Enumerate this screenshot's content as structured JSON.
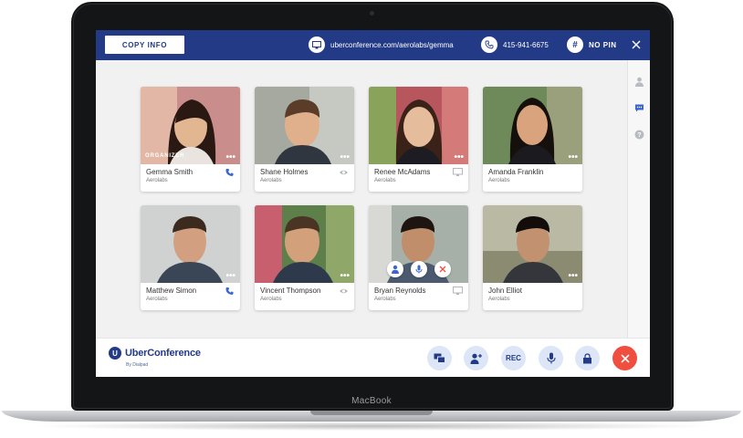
{
  "device": {
    "brand_label": "MacBook"
  },
  "topbar": {
    "copy_info_label": "COPY INFO",
    "conference_url": "uberconference.com/aerolabs/gemma",
    "phone_number": "415-941-6675",
    "pin_label": "NO PIN",
    "icons": [
      "screen-icon",
      "phone-icon",
      "hash-icon",
      "close-icon"
    ]
  },
  "rail": {
    "icons": [
      "person-icon",
      "chat-icon",
      "help-icon"
    ]
  },
  "participants": [
    {
      "name": "Gemma Smith",
      "org": "Aerolabs",
      "badge": "ORGANIZER",
      "status": "phone-icon"
    },
    {
      "name": "Shane Holmes",
      "org": "Aerolabs",
      "status": "eye-icon"
    },
    {
      "name": "Renee McAdams",
      "org": "Aerolabs",
      "status": "monitor-icon"
    },
    {
      "name": "Amanda Franklin",
      "org": "Aerolabs",
      "status": ""
    },
    {
      "name": "Matthew Simon",
      "org": "Aerolabs",
      "status": "phone-icon"
    },
    {
      "name": "Vincent Thompson",
      "org": "Aerolabs",
      "status": "eye-icon"
    },
    {
      "name": "Bryan Reynolds",
      "org": "Aerolabs",
      "status": "monitor-icon"
    },
    {
      "name": "John Elliot",
      "org": "Aerolabs",
      "status": ""
    }
  ],
  "tile_more_label": "•••",
  "bottombar": {
    "logo_text": "UberConference",
    "logo_mark": "U",
    "logo_sub": "By Dialpad",
    "rec_label": "REC"
  },
  "colors": {
    "brand": "#233a86",
    "accent_light": "#dce6f7",
    "end_call": "#f04e3e"
  }
}
